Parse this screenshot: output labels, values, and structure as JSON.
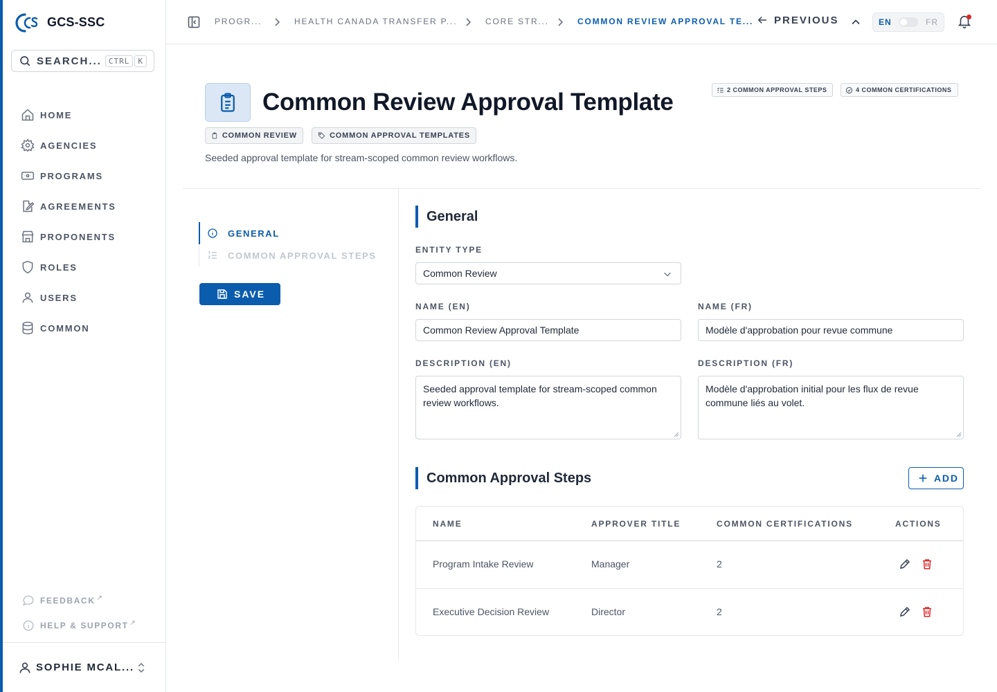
{
  "app": {
    "name": "GCS-SSC",
    "search_label": "SEARCH...",
    "shortcut": [
      "CTRL",
      "K"
    ]
  },
  "colors": {
    "accent": "#0b5cad",
    "danger": "#dc2626"
  },
  "sidebar": {
    "items": [
      {
        "label": "HOME",
        "icon": "home-icon"
      },
      {
        "label": "AGENCIES",
        "icon": "gear-icon"
      },
      {
        "label": "PROGRAMS",
        "icon": "program-icon"
      },
      {
        "label": "AGREEMENTS",
        "icon": "agreement-icon"
      },
      {
        "label": "PROPONENTS",
        "icon": "store-icon"
      },
      {
        "label": "ROLES",
        "icon": "shield-icon"
      },
      {
        "label": "USERS",
        "icon": "user-icon"
      },
      {
        "label": "COMMON",
        "icon": "database-icon"
      }
    ],
    "footer": [
      {
        "label": "FEEDBACK",
        "icon": "chat-icon"
      },
      {
        "label": "HELP & SUPPORT",
        "icon": "info-icon"
      }
    ],
    "user": "SOPHIE MCAL..."
  },
  "topbar": {
    "breadcrumbs": [
      "PROGR...",
      "HEALTH CANADA TRANSFER P...",
      "CORE STR...",
      "COMMON REVIEW APPROVAL TE..."
    ],
    "previous_label": "PREVIOUS",
    "lang_active": "EN",
    "lang_other": "FR"
  },
  "header": {
    "title": "Common Review Approval Template",
    "badges": [
      "2 COMMON APPROVAL STEPS",
      "4 COMMON CERTIFICATIONS"
    ],
    "tags": [
      "COMMON REVIEW",
      "COMMON APPROVAL TEMPLATES"
    ],
    "description": "Seeded approval template for stream-scoped common review workflows."
  },
  "section_nav": {
    "items": [
      "GENERAL",
      "COMMON APPROVAL STEPS"
    ],
    "active": "GENERAL",
    "save_label": "SAVE"
  },
  "general": {
    "heading": "General",
    "entity_type_label": "ENTITY TYPE",
    "entity_type_value": "Common Review",
    "name_en_label": "NAME (EN)",
    "name_en_value": "Common Review Approval Template",
    "name_fr_label": "NAME (FR)",
    "name_fr_value": "Modèle d'approbation pour revue commune",
    "desc_en_label": "DESCRIPTION (EN)",
    "desc_en_value": "Seeded approval template for stream-scoped common review workflows.",
    "desc_fr_label": "DESCRIPTION (FR)",
    "desc_fr_value": "Modèle d'approbation initial pour les flux de revue commune liés au volet."
  },
  "steps": {
    "heading": "Common Approval Steps",
    "add_label": "ADD",
    "columns": [
      "NAME",
      "APPROVER TITLE",
      "COMMON CERTIFICATIONS",
      "ACTIONS"
    ],
    "rows": [
      {
        "name": "Program Intake Review",
        "approver": "Manager",
        "certs": "2"
      },
      {
        "name": "Executive Decision Review",
        "approver": "Director",
        "certs": "2"
      }
    ]
  }
}
